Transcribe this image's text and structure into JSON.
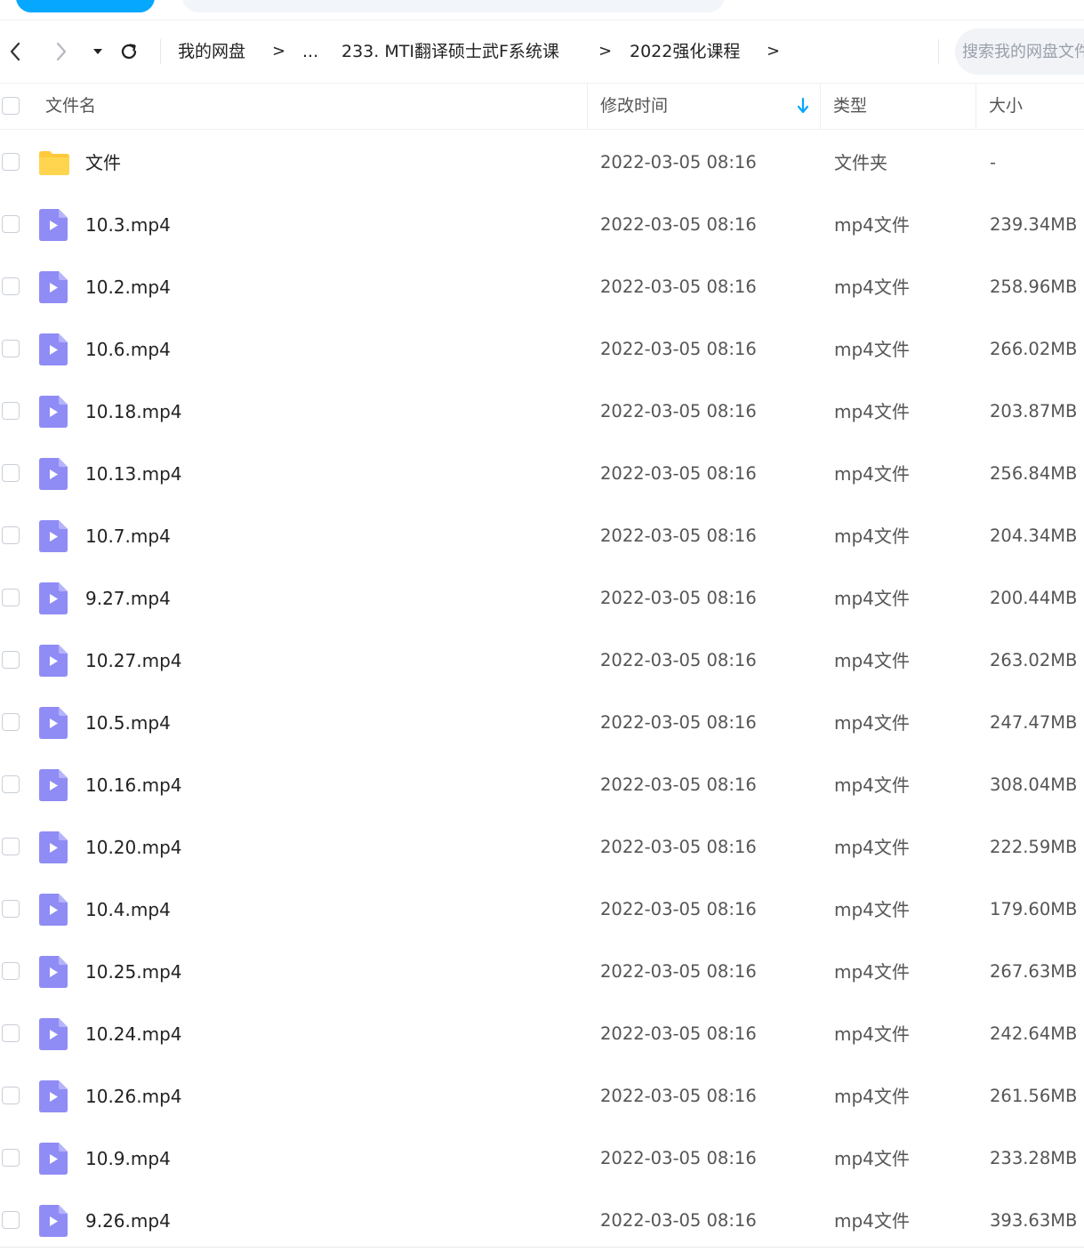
{
  "nav": {
    "breadcrumbs": [
      "我的网盘",
      "...",
      "233. MTI翻译硕士武F系统课",
      "2022强化课程"
    ],
    "separator": ">",
    "search_placeholder": "搜索我的网盘文件"
  },
  "table": {
    "headers": {
      "name": "文件名",
      "modified": "修改时间",
      "type": "类型",
      "size": "大小"
    },
    "sort_indicator": "descending",
    "rows": [
      {
        "name": "文件",
        "modified": "2022-03-05 08:16",
        "type": "文件夹",
        "size": "-",
        "icon": "folder-icon"
      },
      {
        "name": "10.3.mp4",
        "modified": "2022-03-05 08:16",
        "type": "mp4文件",
        "size": "239.34MB",
        "icon": "video-file-icon"
      },
      {
        "name": "10.2.mp4",
        "modified": "2022-03-05 08:16",
        "type": "mp4文件",
        "size": "258.96MB",
        "icon": "video-file-icon"
      },
      {
        "name": "10.6.mp4",
        "modified": "2022-03-05 08:16",
        "type": "mp4文件",
        "size": "266.02MB",
        "icon": "video-file-icon"
      },
      {
        "name": "10.18.mp4",
        "modified": "2022-03-05 08:16",
        "type": "mp4文件",
        "size": "203.87MB",
        "icon": "video-file-icon"
      },
      {
        "name": "10.13.mp4",
        "modified": "2022-03-05 08:16",
        "type": "mp4文件",
        "size": "256.84MB",
        "icon": "video-file-icon"
      },
      {
        "name": "10.7.mp4",
        "modified": "2022-03-05 08:16",
        "type": "mp4文件",
        "size": "204.34MB",
        "icon": "video-file-icon"
      },
      {
        "name": "9.27.mp4",
        "modified": "2022-03-05 08:16",
        "type": "mp4文件",
        "size": "200.44MB",
        "icon": "video-file-icon"
      },
      {
        "name": "10.27.mp4",
        "modified": "2022-03-05 08:16",
        "type": "mp4文件",
        "size": "263.02MB",
        "icon": "video-file-icon"
      },
      {
        "name": "10.5.mp4",
        "modified": "2022-03-05 08:16",
        "type": "mp4文件",
        "size": "247.47MB",
        "icon": "video-file-icon"
      },
      {
        "name": "10.16.mp4",
        "modified": "2022-03-05 08:16",
        "type": "mp4文件",
        "size": "308.04MB",
        "icon": "video-file-icon"
      },
      {
        "name": "10.20.mp4",
        "modified": "2022-03-05 08:16",
        "type": "mp4文件",
        "size": "222.59MB",
        "icon": "video-file-icon"
      },
      {
        "name": "10.4.mp4",
        "modified": "2022-03-05 08:16",
        "type": "mp4文件",
        "size": "179.60MB",
        "icon": "video-file-icon"
      },
      {
        "name": "10.25.mp4",
        "modified": "2022-03-05 08:16",
        "type": "mp4文件",
        "size": "267.63MB",
        "icon": "video-file-icon"
      },
      {
        "name": "10.24.mp4",
        "modified": "2022-03-05 08:16",
        "type": "mp4文件",
        "size": "242.64MB",
        "icon": "video-file-icon"
      },
      {
        "name": "10.26.mp4",
        "modified": "2022-03-05 08:16",
        "type": "mp4文件",
        "size": "261.56MB",
        "icon": "video-file-icon"
      },
      {
        "name": "10.9.mp4",
        "modified": "2022-03-05 08:16",
        "type": "mp4文件",
        "size": "233.28MB",
        "icon": "video-file-icon"
      },
      {
        "name": "9.26.mp4",
        "modified": "2022-03-05 08:16",
        "type": "mp4文件",
        "size": "393.63MB",
        "icon": "video-file-icon"
      }
    ]
  },
  "colors": {
    "accent": "#06a7ff",
    "folder": "#ffc93c",
    "video_icon": "#8f8cf5"
  }
}
